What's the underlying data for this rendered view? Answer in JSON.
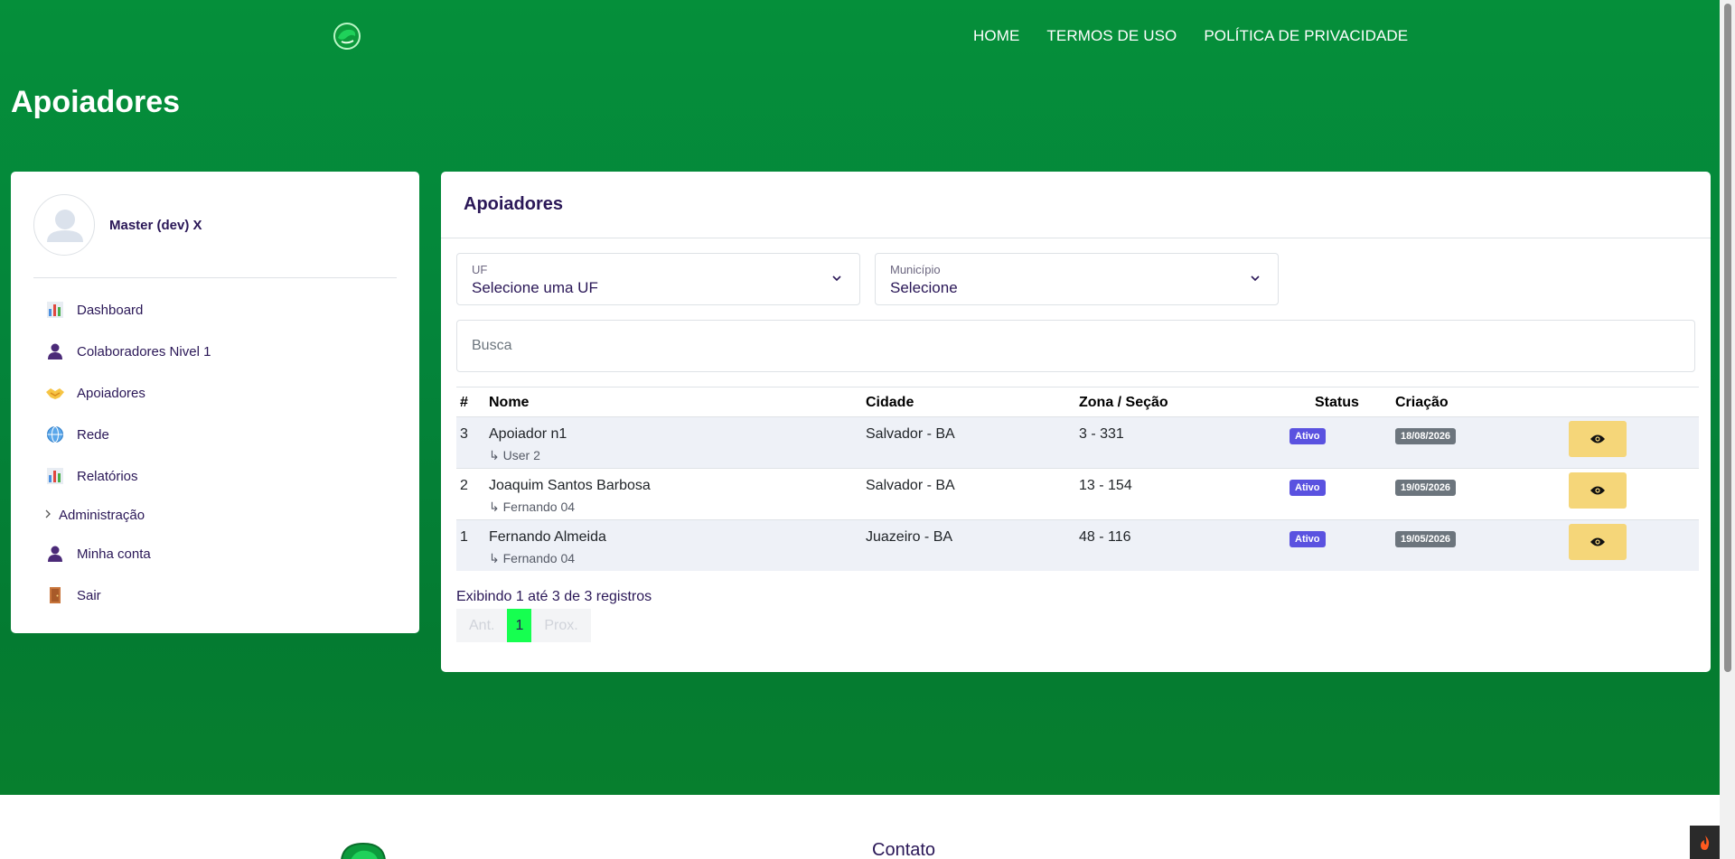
{
  "nav": {
    "items": [
      "HOME",
      "TERMOS DE USO",
      "POLÍTICA DE PRIVACIDADE"
    ]
  },
  "page": {
    "title": "Apoiadores"
  },
  "sidebar": {
    "user_name": "Master (dev) X",
    "items": [
      {
        "label": "Dashboard",
        "icon": "bar-chart-icon"
      },
      {
        "label": "Colaboradores Nivel 1",
        "icon": "person-icon"
      },
      {
        "label": "Apoiadores",
        "icon": "handshake-icon"
      },
      {
        "label": "Rede",
        "icon": "globe-icon"
      },
      {
        "label": "Relatórios",
        "icon": "bar-chart-icon"
      },
      {
        "label": "Administração",
        "icon": "chevron-right-icon"
      },
      {
        "label": "Minha conta",
        "icon": "person-icon"
      },
      {
        "label": "Sair",
        "icon": "door-icon"
      }
    ]
  },
  "main": {
    "title": "Apoiadores",
    "filters": {
      "uf": {
        "label": "UF",
        "value": "Selecione uma UF"
      },
      "municipio": {
        "label": "Município",
        "value": "Selecione"
      }
    },
    "search": {
      "placeholder": "Busca"
    },
    "table": {
      "headers": [
        "#",
        "Nome",
        "Cidade",
        "Zona / Seção",
        "Status",
        "Criação"
      ],
      "rows": [
        {
          "id": "3",
          "nome": "Apoiador n1",
          "ref": "↳ User 2",
          "cidade": "Salvador - BA",
          "zona": "3 - 331",
          "status": "Ativo",
          "criacao": "18/08/2026"
        },
        {
          "id": "2",
          "nome": "Joaquim Santos Barbosa",
          "ref": "↳ Fernando 04",
          "cidade": "Salvador - BA",
          "zona": "13 - 154",
          "status": "Ativo",
          "criacao": "19/05/2026"
        },
        {
          "id": "1",
          "nome": "Fernando Almeida",
          "ref": "↳ Fernando 04",
          "cidade": "Juazeiro - BA",
          "zona": "48 - 116",
          "status": "Ativo",
          "criacao": "19/05/2026"
        }
      ]
    },
    "info": "Exibindo 1 até 3 de 3 registros",
    "pagination": {
      "prev": "Ant.",
      "current": "1",
      "next": "Prox."
    }
  },
  "footer": {
    "contact_title": "Contato"
  },
  "colors": {
    "brand_green": "#058f3a",
    "status_badge": "#5a52e0",
    "date_badge": "#6c757d",
    "view_button": "#f5d679",
    "active_page": "#16ff50",
    "text_dark_purple": "#2a1757"
  }
}
